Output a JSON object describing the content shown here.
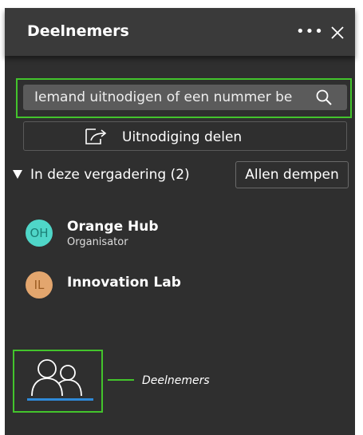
{
  "header": {
    "title": "Deelnemers",
    "more_label": "•••",
    "more_icon": "ellipsis-icon",
    "close_icon": "close-icon"
  },
  "search": {
    "placeholder": "Iemand uitnodigen of een nummer be",
    "icon": "search-icon"
  },
  "invite": {
    "label": "Uitnodiging delen",
    "icon": "share-icon"
  },
  "section": {
    "label": "In deze vergadering (2)",
    "expanded": true
  },
  "mute_all": {
    "label": "Allen dempen"
  },
  "participants": [
    {
      "initials": "OH",
      "name": "Orange Hub",
      "role": "Organisator",
      "avatar_color": "#4fd6c8",
      "initials_color": "#1c7f76"
    },
    {
      "initials": "IL",
      "name": "Innovation Lab",
      "role": "",
      "avatar_color": "#e3a66e",
      "initials_color": "#9b5c22"
    }
  ],
  "bottom_bar": {
    "participants_icon": "people-icon",
    "callout_label": "Deelnemers"
  },
  "colors": {
    "panel_bg": "#2f2f2f",
    "header_bg": "#3a3a3a",
    "highlight": "#43c42c",
    "active_underline": "#2f8ad8"
  }
}
